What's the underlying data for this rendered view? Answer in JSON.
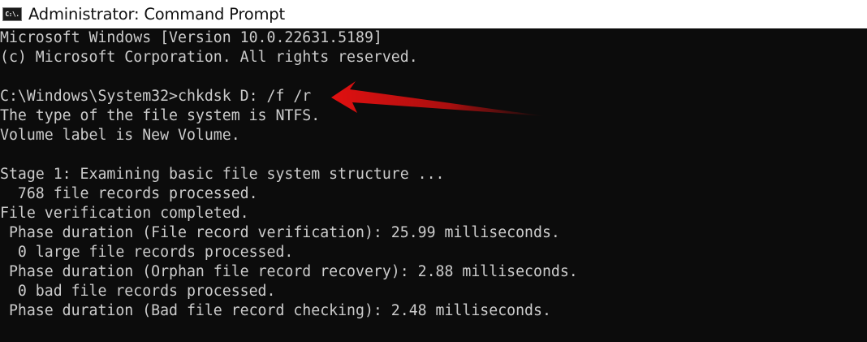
{
  "window": {
    "title": "Administrator: Command Prompt",
    "icon": "command-prompt-icon",
    "icon_text": "C:\\."
  },
  "console": {
    "lines": [
      "Microsoft Windows [Version 10.0.22631.5189]",
      "(c) Microsoft Corporation. All rights reserved.",
      "",
      "C:\\Windows\\System32>chkdsk D: /f /r",
      "The type of the file system is NTFS.",
      "Volume label is New Volume.",
      "",
      "Stage 1: Examining basic file system structure ...",
      "  768 file records processed.",
      "File verification completed.",
      " Phase duration (File record verification): 25.99 milliseconds.",
      "  0 large file records processed.",
      " Phase duration (Orphan file record recovery): 2.88 milliseconds.",
      "  0 bad file records processed.",
      " Phase duration (Bad file record checking): 2.48 milliseconds."
    ]
  },
  "annotation": {
    "icon": "red-arrow-icon",
    "color": "#e01010"
  },
  "colors": {
    "console_background": "#0c0c0c",
    "console_text": "#cccccc",
    "titlebar_background": "#ffffff",
    "title_text": "#111111"
  }
}
